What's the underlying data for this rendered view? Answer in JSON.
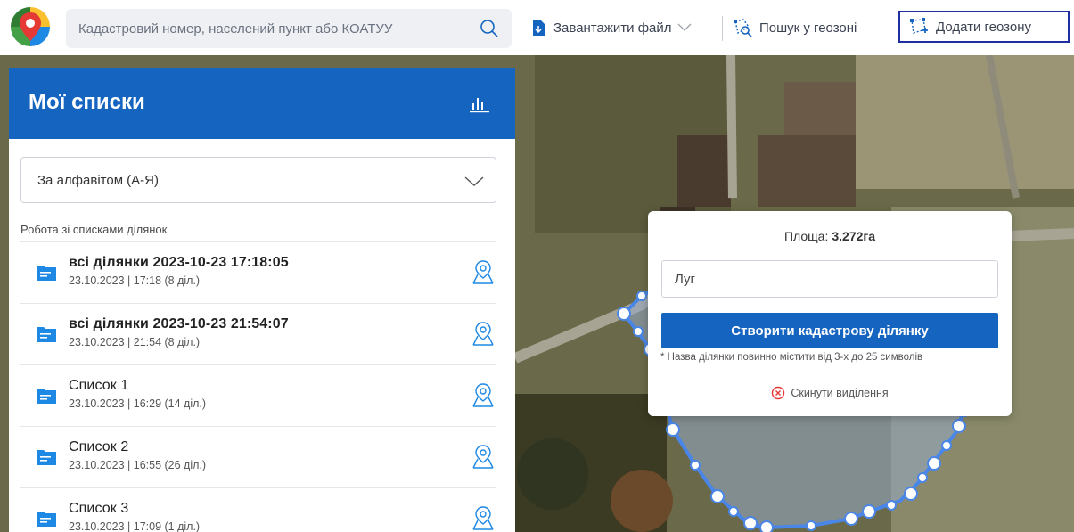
{
  "toolbar": {
    "search_placeholder": "Кадастровий номер, населений пункт або КОАТУУ",
    "upload_label": "Завантажити файл",
    "geo_search_label": "Пошук у геозоні",
    "add_geozone_label": "Додати геозону"
  },
  "sidebar": {
    "title": "Мої списки",
    "sort_value": "За алфавітом (А-Я)",
    "section_label": "Робота зі списками ділянок",
    "items": [
      {
        "title": "всі ділянки 2023-10-23 17:18:05",
        "subtitle": "23.10.2023 | 17:18 (8 діл.)"
      },
      {
        "title": "всі ділянки 2023-10-23 21:54:07",
        "subtitle": "23.10.2023 | 21:54 (8 діл.)"
      },
      {
        "title": "Список 1",
        "subtitle": "23.10.2023 | 16:29 (14 діл.)"
      },
      {
        "title": "Список 2",
        "subtitle": "23.10.2023 | 16:55 (26 діл.)"
      },
      {
        "title": "Список 3",
        "subtitle": "23.10.2023 | 17:09 (1 діл.)"
      }
    ]
  },
  "popup": {
    "area_label": "Площа:",
    "area_value": "3.272га",
    "name_value": "Луг",
    "create_label": "Створити кадастрову ділянку",
    "hint": "* Назва ділянки повинно містити від 3-х до 25 символів",
    "reset_label": "Скинути виділення"
  },
  "colors": {
    "primary": "#1565c0",
    "geozone_line": "#4a86e8",
    "focus_border": "#1f2e9c"
  }
}
